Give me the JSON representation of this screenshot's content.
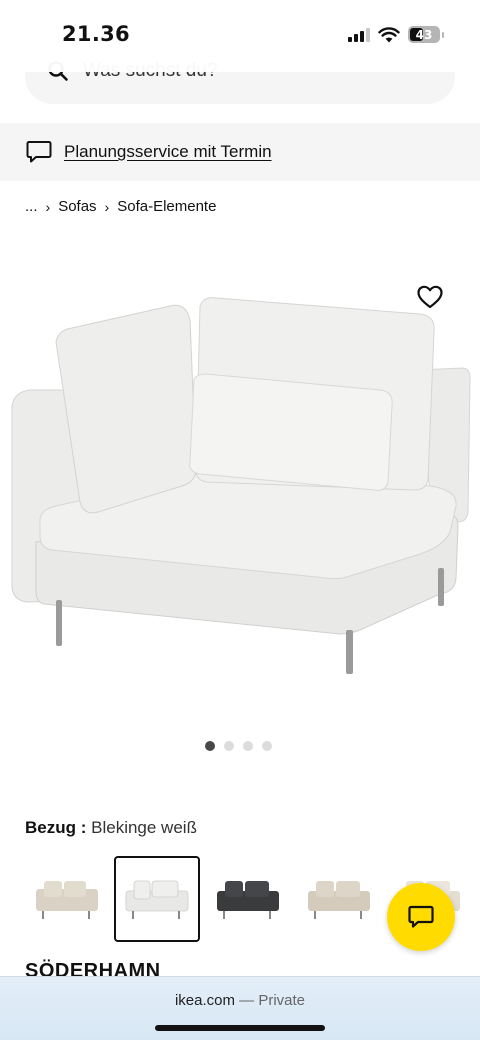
{
  "status_bar": {
    "time": "21.36",
    "battery": "43"
  },
  "search": {
    "placeholder": "Was suchst du?"
  },
  "planning_banner": {
    "link_label": "Planungsservice mit Termin"
  },
  "breadcrumb": {
    "items": [
      "...",
      "Sofas",
      "Sofa-Elemente"
    ]
  },
  "carousel": {
    "total": 4,
    "active_index": 0
  },
  "cover": {
    "label": "Bezug :",
    "value": "Blekinge weiß"
  },
  "swatches": [
    {
      "name": "beige",
      "color": "#d9d2c5",
      "selected": false
    },
    {
      "name": "weiss",
      "color": "#e8e8e6",
      "selected": true
    },
    {
      "name": "dunkelgrau",
      "color": "#3a3b3d",
      "selected": false
    },
    {
      "name": "hellbeige",
      "color": "#d4cbbd",
      "selected": false
    },
    {
      "name": "creme",
      "color": "#e4ddd2",
      "selected": false
    }
  ],
  "product": {
    "title": "SÖDERHAMN"
  },
  "browser": {
    "domain": "ikea.com",
    "separator": "—",
    "mode": "Private"
  },
  "colors": {
    "chat_fab": "#ffdb00",
    "banner_bg": "#f5f5f5"
  }
}
